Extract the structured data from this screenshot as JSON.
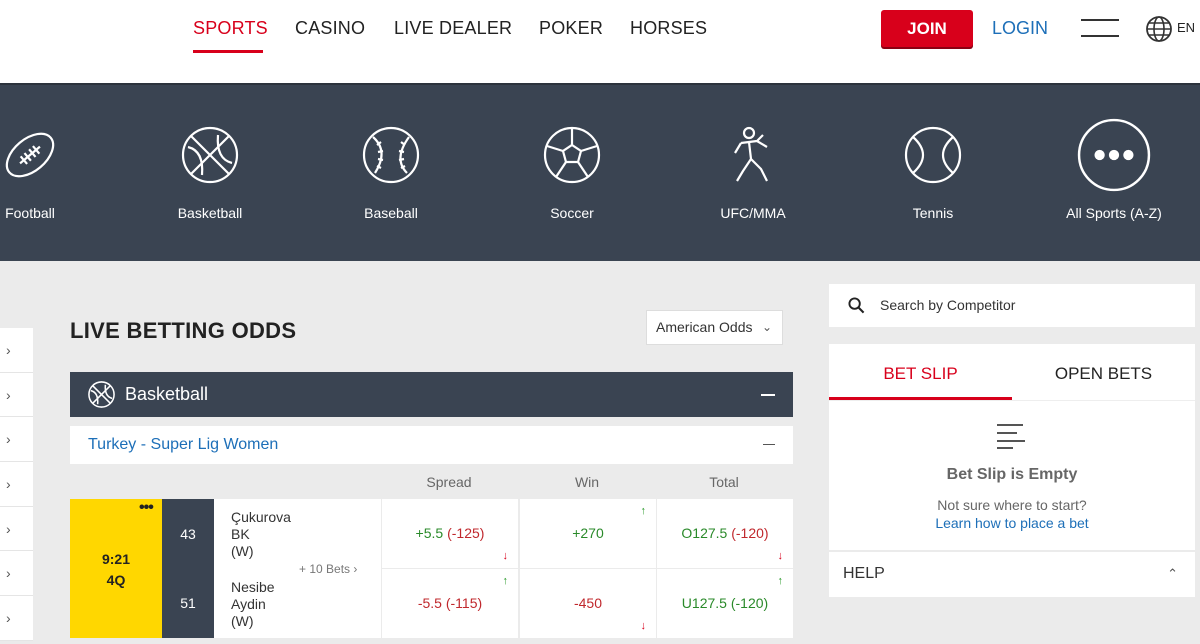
{
  "nav": {
    "items": [
      "SPORTS",
      "CASINO",
      "LIVE DEALER",
      "POKER",
      "HORSES"
    ],
    "join_label": "JOIN",
    "login_label": "LOGIN",
    "lang": "EN",
    "accent": "#d8001b"
  },
  "sports": [
    {
      "label": "Football",
      "icon": "football-icon"
    },
    {
      "label": "Basketball",
      "icon": "basketball-icon"
    },
    {
      "label": "Baseball",
      "icon": "baseball-icon"
    },
    {
      "label": "Soccer",
      "icon": "soccer-icon"
    },
    {
      "label": "UFC/MMA",
      "icon": "fighter-icon"
    },
    {
      "label": "Tennis",
      "icon": "tennis-icon"
    },
    {
      "label": "All Sports (A-Z)",
      "icon": "more-dots-icon"
    }
  ],
  "main": {
    "title": "LIVE BETTING ODDS",
    "odds_format": "American Odds",
    "sport_header": "Basketball",
    "league": "Turkey - Super Lig Women",
    "columns": [
      "Spread",
      "Win",
      "Total"
    ],
    "match": {
      "clock": "9:21",
      "period": "4Q",
      "more_icon": "•••",
      "more_bets": "+ 10 Bets ›",
      "team1": {
        "name1": "Çukurova",
        "name2": "BK",
        "name3": "(W)",
        "score": "43"
      },
      "team2": {
        "name1": "Nesibe",
        "name2": "Aydin",
        "name3": "(W)",
        "score": "51"
      },
      "row1": {
        "spread_a": "+5.5",
        "spread_b": "(-125)",
        "win": "+270",
        "total_a": "O127.5",
        "total_b": "(-120)"
      },
      "row2": {
        "spread_a": "-5.5",
        "spread_b": "(-115)",
        "win": "-450",
        "total_a": "U127.5",
        "total_b": "(-120)"
      }
    }
  },
  "right": {
    "search_placeholder": "Search by Competitor",
    "tabs": [
      "BET SLIP",
      "OPEN BETS"
    ],
    "empty_title": "Bet Slip is Empty",
    "empty_sub": "Not sure where to start?",
    "empty_link": "Learn how to place a bet",
    "help": "HELP"
  }
}
